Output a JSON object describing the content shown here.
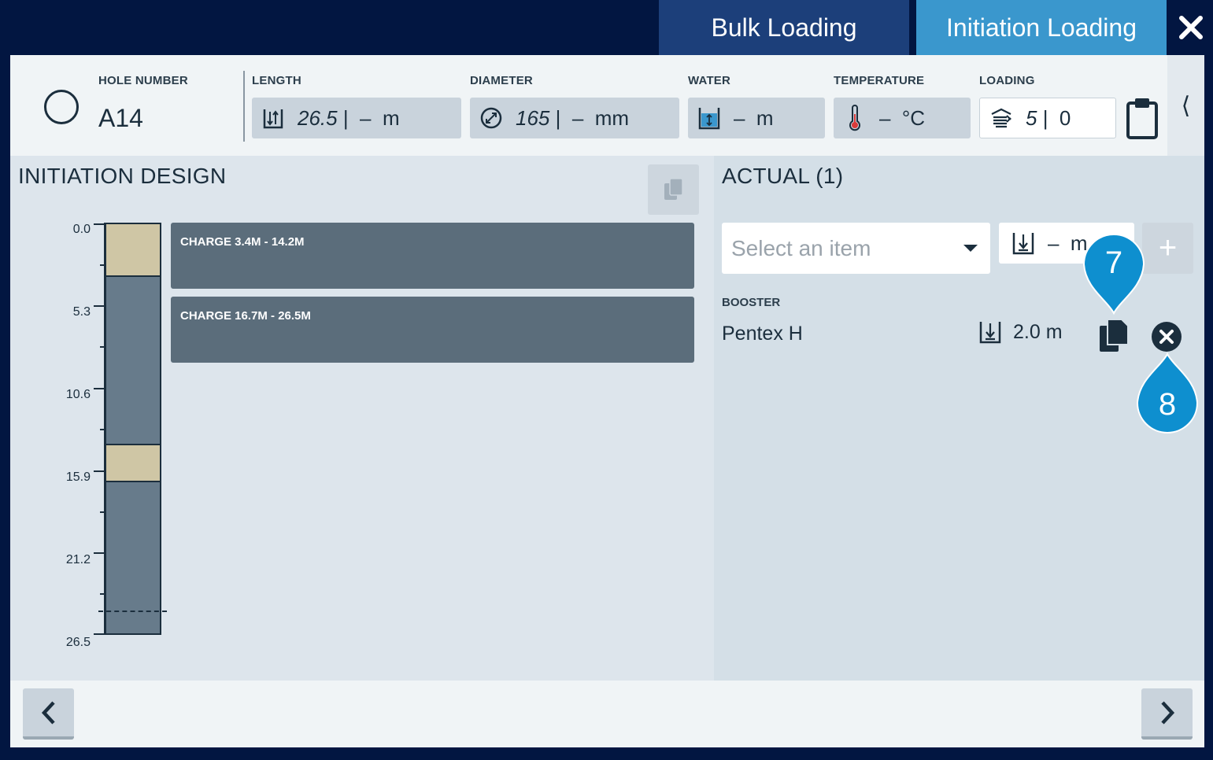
{
  "tabs": {
    "bulk_loading": "Bulk Loading",
    "initiation_loading": "Initiation Loading",
    "active": "Initiation Loading"
  },
  "header": {
    "hole_number_label": "HOLE NUMBER",
    "hole_number": "A14",
    "length_label": "LENGTH",
    "length_value": "26.5",
    "length_rest": " |  –  m",
    "diameter_label": "DIAMETER",
    "diameter_value": "165",
    "diameter_rest": " |  –  mm",
    "water_label": "WATER",
    "water_value": "–  m",
    "temperature_label": "TEMPERATURE",
    "temperature_value": "–  °C",
    "loading_label": "LOADING",
    "loading_value": "5",
    "loading_rest": " |  0",
    "collapse_glyph": "⟨"
  },
  "design": {
    "title": "INITIATION DESIGN",
    "charges": [
      {
        "label": "CHARGE 3.4M - 14.2M"
      },
      {
        "label": "CHARGE 16.7M - 26.5M"
      }
    ],
    "scale_ticks": [
      "0.0",
      "5.3",
      "10.6",
      "15.9",
      "21.2",
      "26.5"
    ],
    "column_segments": [
      {
        "type": "stemming",
        "from": 0.0,
        "to": 3.4
      },
      {
        "type": "explosive",
        "from": 3.4,
        "to": 14.2
      },
      {
        "type": "stemming",
        "from": 14.2,
        "to": 16.7
      },
      {
        "type": "explosive",
        "from": 16.7,
        "to": 26.5
      }
    ]
  },
  "actual": {
    "title": "ACTUAL (1)",
    "select_placeholder": "Select an item",
    "depth_placeholder": "–  m",
    "add_label": "+",
    "category_label": "BOOSTER",
    "product_name": "Pentex H",
    "product_depth": "2.0 m"
  },
  "callouts": {
    "seven": "7",
    "eight": "8"
  },
  "colors": {
    "navy": "#021641",
    "tab_inactive": "#1c3f7a",
    "tab_active": "#3a97cd",
    "charge_bar": "#5b6d7b",
    "stemming": "#cfc6a5",
    "explosive": "#677b8b",
    "callout": "#0e8fcf"
  }
}
